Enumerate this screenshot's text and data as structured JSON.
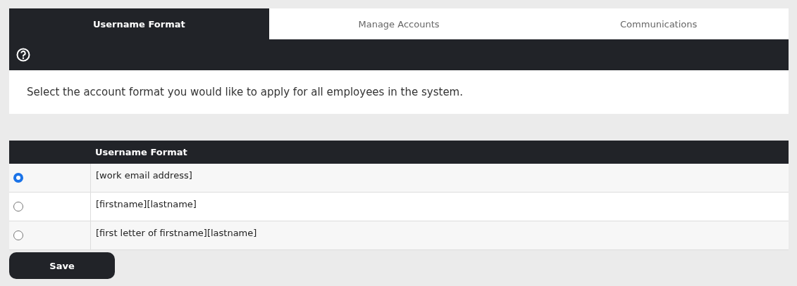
{
  "tabs": [
    {
      "label": "Username Format",
      "selected": true
    },
    {
      "label": "Manage Accounts",
      "selected": false
    },
    {
      "label": "Communications",
      "selected": false
    }
  ],
  "intro": "Select the account format you would like to apply for all employees in the system.",
  "table": {
    "columns": [
      "",
      "Username Format"
    ],
    "rows": [
      {
        "format": "[work email address]",
        "selected": true
      },
      {
        "format": "[firstname][lastname]",
        "selected": false
      },
      {
        "format": "[first letter of firstname][lastname]",
        "selected": false
      }
    ]
  },
  "save_button": "Save"
}
